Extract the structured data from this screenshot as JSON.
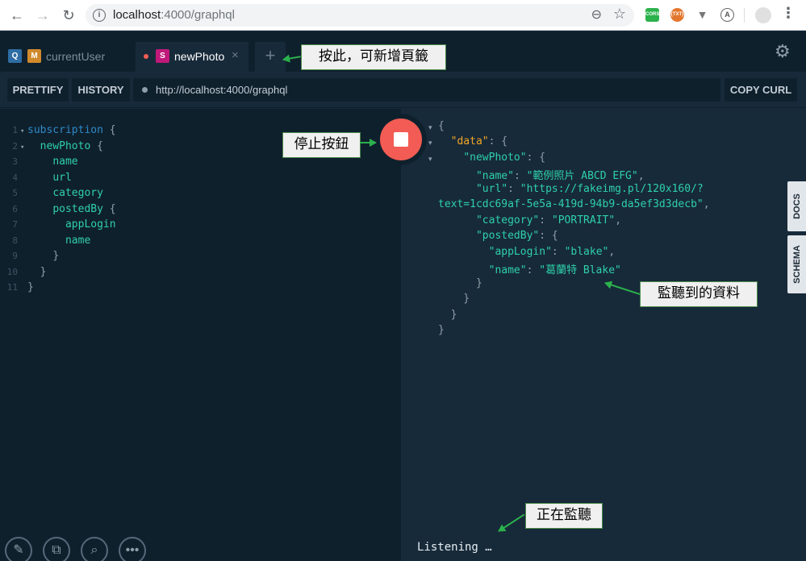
{
  "browser": {
    "url_host": "localhost",
    "url_rest": ":4000/graphql",
    "extensions": [
      {
        "name": "cors-extension-icon",
        "label": "CORS",
        "color": "#2bb24c"
      },
      {
        "name": "json-extension-icon",
        "label": "{TXT}",
        "color": "#e3772e"
      },
      {
        "name": "vue-devtools-icon",
        "label": "",
        "color": "#888888"
      },
      {
        "name": "angular-icon",
        "label": "",
        "color": "#888888"
      }
    ]
  },
  "tabs": [
    {
      "label": "currentUser",
      "badges": [
        "Q",
        "M"
      ],
      "badge_colors": [
        "#2e6da4",
        "#d08a2c"
      ]
    },
    {
      "label": "newPhoto",
      "badges": [
        "S"
      ],
      "badge_colors": [
        "#c0197a"
      ],
      "active": true
    }
  ],
  "toolbar": {
    "prettify": "PRETTIFY",
    "history": "HISTORY",
    "endpoint": "http://localhost:4000/graphql",
    "copy_curl": "COPY CURL"
  },
  "query_lines": [
    {
      "n": "1",
      "fold": true,
      "text": ""
    },
    {
      "n": "2",
      "fold": true,
      "text": ""
    },
    {
      "n": "3",
      "text": ""
    },
    {
      "n": "4",
      "text": ""
    },
    {
      "n": "5",
      "text": ""
    },
    {
      "n": "6",
      "text": ""
    },
    {
      "n": "7",
      "text": ""
    },
    {
      "n": "8",
      "text": ""
    },
    {
      "n": "9",
      "text": ""
    },
    {
      "n": "10",
      "text": ""
    },
    {
      "n": "11",
      "text": ""
    }
  ],
  "query": {
    "keyword": "subscription",
    "root_field": "newPhoto",
    "fields": [
      "name",
      "url",
      "category",
      "postedBy"
    ],
    "sub_fields": [
      "appLogin",
      "name"
    ]
  },
  "result": {
    "data_key": "\"data\"",
    "newPhoto_key": "\"newPhoto\"",
    "name_key": "\"name\"",
    "name_val": "\"範例照片 ABCD EFG\"",
    "url_key": "\"url\"",
    "url_val_1": "\"https://fakeimg.pl/120x160/?",
    "url_val_2": "text=1cdc69af-5e5a-419d-94b9-da5ef3d3decb\"",
    "category_key": "\"category\"",
    "category_val": "\"PORTRAIT\"",
    "postedBy_key": "\"postedBy\"",
    "appLogin_key": "\"appLogin\"",
    "appLogin_val": "\"blake\"",
    "pname_key": "\"name\"",
    "pname_val": "\"葛蘭特 Blake\"",
    "status": "Listening …"
  },
  "side_tabs": {
    "docs": "DOCS",
    "schema": "SCHEMA"
  },
  "annotations": {
    "new_tab": "按此，可新增頁籤",
    "stop_button": "停止按鈕",
    "received_data": "監聽到的資料",
    "listening": "正在監聽"
  }
}
